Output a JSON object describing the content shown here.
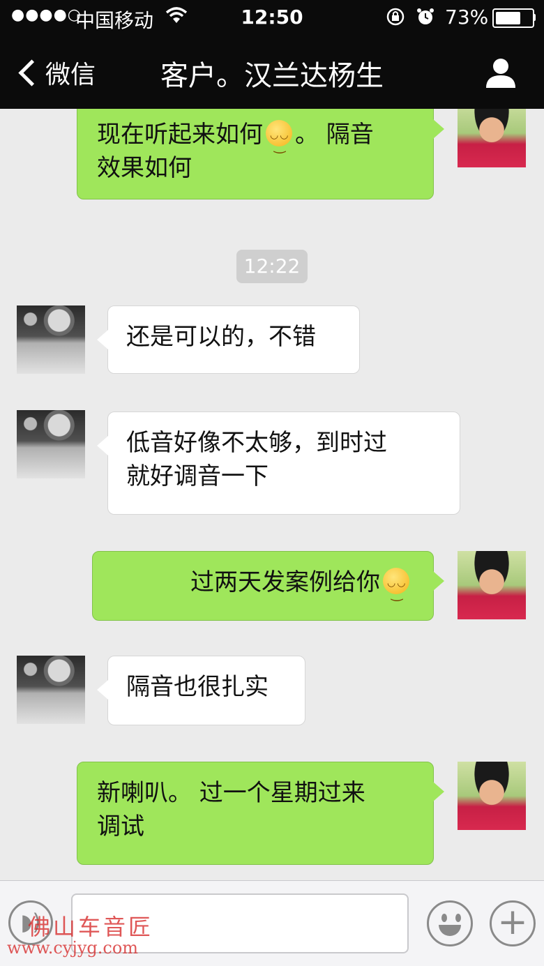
{
  "status_bar": {
    "signal": "●●●●○",
    "carrier": "中国移动",
    "wifi_icon": "wifi-icon",
    "time": "12:50",
    "rotation_lock_icon": "rotation-lock-icon",
    "alarm_icon": "alarm-icon",
    "battery_percent": "73%",
    "battery_level": 0.73
  },
  "nav": {
    "back_label": "微信",
    "title": "客户。汉兰达杨生",
    "profile_icon": "person-icon"
  },
  "messages": [
    {
      "side": "out",
      "text": "现在听起来如何",
      "emoji": true,
      "text_after": "。 隔音",
      "text_line2": "效果如何"
    },
    {
      "type": "timestamp",
      "text": "12:22"
    },
    {
      "side": "in",
      "text": "还是可以的，不错"
    },
    {
      "side": "in",
      "text": "低音好像不太够，到时过",
      "text_line2": "就好调音一下"
    },
    {
      "side": "out",
      "text": "过两天发案例给你",
      "emoji": true
    },
    {
      "side": "in",
      "text": "隔音也很扎实"
    },
    {
      "side": "out",
      "text": "新喇叭。 过一个星期过来",
      "text_line2": "调试"
    }
  ],
  "input_bar": {
    "voice_icon": "voice-icon",
    "input_value": "",
    "emoji_icon": "emoji-icon",
    "plus_icon": "plus-icon"
  },
  "watermark": {
    "line1": "佛山车音匠",
    "line2": "www.cyjyg.com"
  },
  "colors": {
    "nav_bg": "#0b0b0b",
    "chat_bg": "#ebebeb",
    "outgoing_bubble": "#9fe65b",
    "incoming_bubble": "#ffffff"
  }
}
